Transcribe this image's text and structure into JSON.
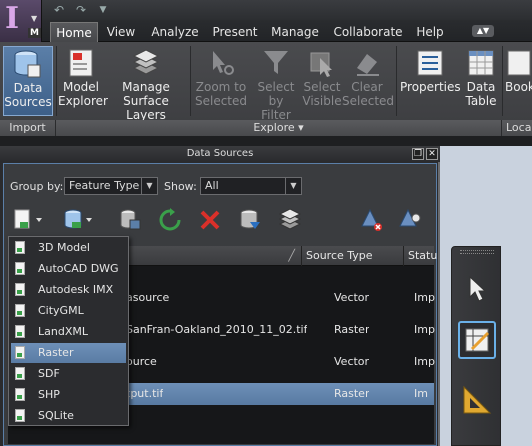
{
  "app": {
    "logo_letter": "I",
    "logo_sub": "M"
  },
  "tabs": [
    {
      "label": "Home",
      "active": true
    },
    {
      "label": "View"
    },
    {
      "label": "Analyze"
    },
    {
      "label": "Present"
    },
    {
      "label": "Manage"
    },
    {
      "label": "Collaborate"
    },
    {
      "label": "Help"
    }
  ],
  "ribbon": {
    "import": {
      "panel_label": "Import",
      "data_sources": [
        "Data",
        "Sources"
      ]
    },
    "explore": {
      "panel_label": "Explore ▾",
      "model_explorer": [
        "Model",
        "Explorer"
      ],
      "manage_surface_layers": [
        "Manage",
        "Surface Layers"
      ],
      "zoom_to_selected": [
        "Zoom to",
        "Selected"
      ],
      "select_by_filter": [
        "Select by",
        "Filter"
      ],
      "select_visible": [
        "Select",
        "Visible"
      ],
      "clear_selected": [
        "Clear",
        "Selected"
      ]
    },
    "properties": "Properties",
    "data_table": [
      "Data",
      "Table"
    ],
    "bookmarks": "Book",
    "location_panel_label": "Loca"
  },
  "data_sources_panel": {
    "title": "Data Sources",
    "group_by_label": "Group by:",
    "group_by_value": "Feature Type",
    "show_label": "Show:",
    "show_value": "All",
    "columns": [
      "",
      "Source Type",
      "Statu"
    ],
    "rows": [
      {
        "name": "asource",
        "type": "Vector",
        "status": "Imp",
        "selected": false
      },
      {
        "name": "-SanFran-Oakland_2010_11_02.tif",
        "type": "Raster",
        "status": "Imp",
        "selected": false
      },
      {
        "name": "ource",
        "type": "Vector",
        "status": "Imp",
        "selected": false
      },
      {
        "name": "tput.tif",
        "type": "Raster",
        "status": "Im",
        "selected": true
      }
    ]
  },
  "add_menu": {
    "items": [
      "3D Model",
      "AutoCAD DWG",
      "Autodesk IMX",
      "CityGML",
      "LandXML",
      "Raster",
      "SDF",
      "SHP",
      "SQLite"
    ],
    "hover_item": "Raster"
  },
  "colors": {
    "accent": "#5b7fa8",
    "selection": "#6e90b8",
    "panel_bg": "#3a3c3f",
    "workspace_bg": "#c9d2de"
  }
}
